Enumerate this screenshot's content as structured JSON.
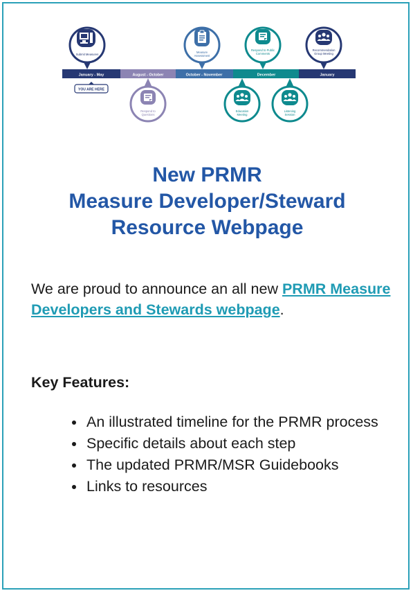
{
  "timeline": {
    "segments": [
      {
        "label": "January - May",
        "color": "#263873"
      },
      {
        "label": "August - October",
        "color": "#8c84b3"
      },
      {
        "label": "October - November",
        "color": "#3d6fa8"
      },
      {
        "label": "December",
        "color": "#0e8a8e"
      },
      {
        "label": "January",
        "color": "#263873"
      }
    ],
    "milestones": [
      {
        "label": "Submit Measures",
        "icon": "computer-icon",
        "color": "#263873"
      },
      {
        "label": "Respond to Questions",
        "icon": "document-icon",
        "color": "#8c84b3"
      },
      {
        "label": "Measure Assessment",
        "icon": "clipboard-icon",
        "color": "#3d6fa8"
      },
      {
        "label": "Respond to Public Comments",
        "icon": "document-icon",
        "color": "#0e8a8e"
      },
      {
        "label": "Education Meeting",
        "icon": "group-icon",
        "color": "#0e8a8e"
      },
      {
        "label": "Listening Session",
        "icon": "group-icon",
        "color": "#0e8a8e"
      },
      {
        "label": "Recommendation Group Meeting",
        "icon": "group-icon",
        "color": "#263873"
      }
    ],
    "you_are_here": "YOU ARE HERE"
  },
  "title": {
    "line1": "New PRMR",
    "line2": "Measure Developer/Steward",
    "line3": "Resource Webpage"
  },
  "intro": {
    "text_before": "We are proud to announce an all new ",
    "link_text": "PRMR Measure Developers and Stewards webpage",
    "text_after": "."
  },
  "features": {
    "heading": "Key Features:",
    "items": [
      "An illustrated timeline for the PRMR process",
      "Specific details about each step",
      "The updated PRMR/MSR Guidebooks",
      "Links to resources"
    ]
  }
}
